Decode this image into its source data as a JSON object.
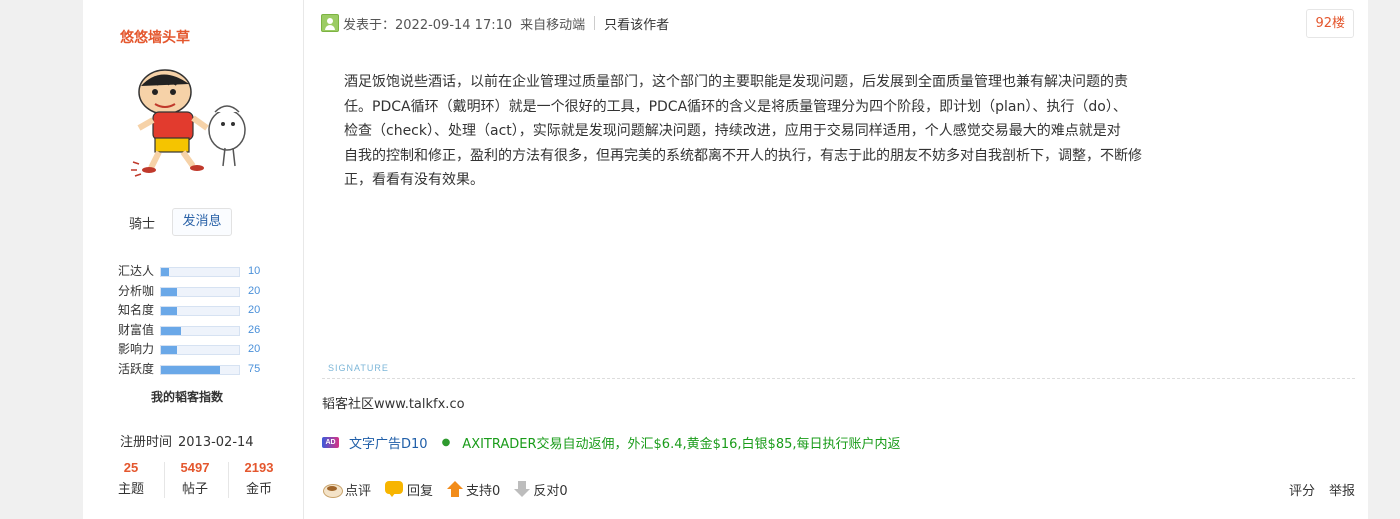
{
  "user": {
    "name": "悠悠墙头草",
    "rank": "骑士",
    "pm_button": "发消息",
    "stats": [
      {
        "label": "汇达人",
        "value": "10",
        "level": 10
      },
      {
        "label": "分析咖",
        "value": "20",
        "level": 20
      },
      {
        "label": "知名度",
        "value": "20",
        "level": 20
      },
      {
        "label": "财富值",
        "value": "26",
        "level": 26
      },
      {
        "label": "影响力",
        "value": "20",
        "level": 20
      },
      {
        "label": "活跃度",
        "value": "75",
        "level": 75
      }
    ],
    "index_title": "我的韬客指数",
    "reg_label": "注册时间",
    "reg_date": "2013-02-14",
    "counts": [
      {
        "num": "25",
        "label": "主题"
      },
      {
        "num": "5497",
        "label": "帖子"
      },
      {
        "num": "2193",
        "label": "金币"
      }
    ]
  },
  "post": {
    "posted_at": "发表于：2022-09-14 17:10",
    "from": "来自移动端",
    "author_only": "只看该作者",
    "floor": "92楼",
    "body": [
      "酒足饭饱说些酒话，以前在企业管理过质量部门，这个部门的主要职能是发现问题，后发展到全面质量管理也兼有解决问题的责",
      "任。PDCA循环（戴明环）就是一个很好的工具，PDCA循环的含义是将质量管理分为四个阶段，即计划（plan）、执行（do）、",
      "检查（check）、处理（act），实际就是发现问题解决问题，持续改进，应用于交易同样适用，个人感觉交易最大的难点就是对",
      "自我的控制和修正，盈利的方法有很多，但再完美的系统都离不开人的执行，有志于此的朋友不妨多对自我剖析下，调整，不断修",
      "正，看看有没有效果。"
    ],
    "signature_label": "SIGNATURE",
    "signature": "韬客社区www.talkfx.co",
    "ad": {
      "badge": "AD",
      "type": "文字广告D10",
      "dot": "●",
      "text": "AXITRADER交易自动返佣，外汇$6.4,黄金$16,白银$85,每日执行账户内返"
    },
    "actions": {
      "comment": "点评",
      "reply": "回复",
      "support": "支持0",
      "oppose": "反对0",
      "rate": "评分",
      "report": "举报"
    }
  },
  "colors": {
    "accent": "#e4572e",
    "link": "#1f5ea8",
    "ad_green": "#1a9c1a",
    "bar_fill": "#6aa8e8"
  }
}
